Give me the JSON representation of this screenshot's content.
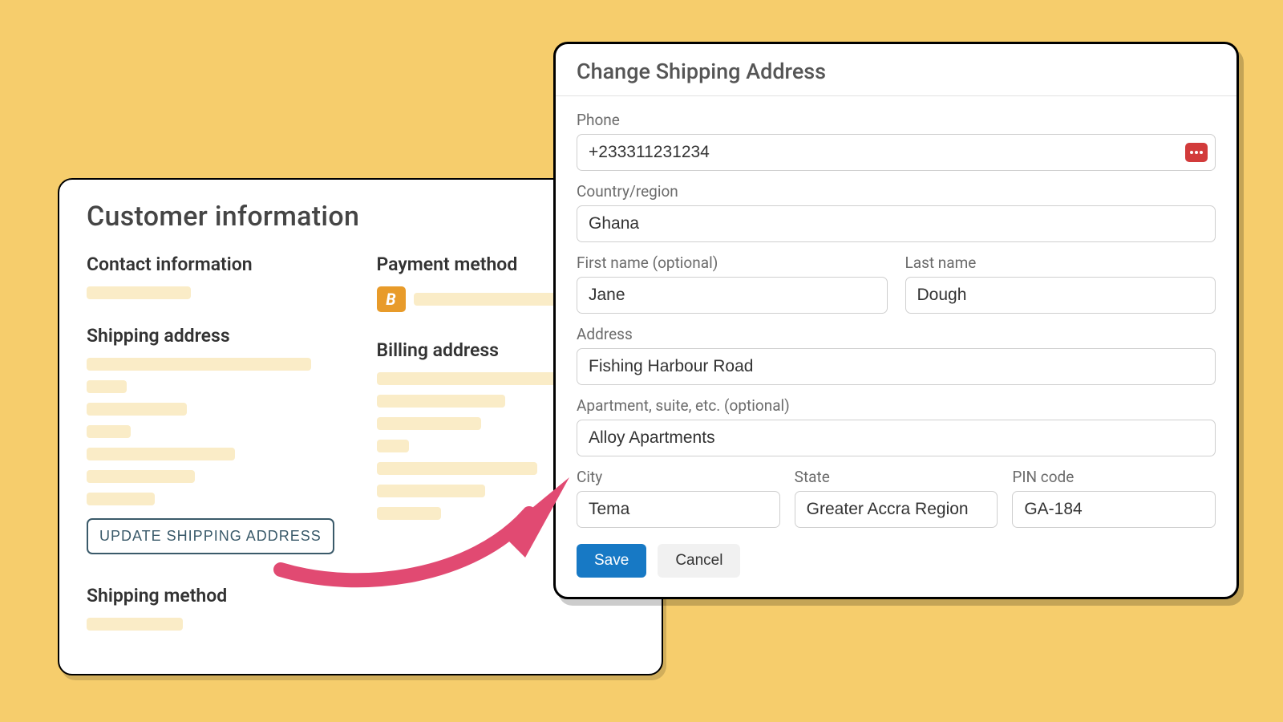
{
  "left": {
    "title": "Customer information",
    "contact_heading": "Contact information",
    "payment_heading": "Payment method",
    "payment_badge": "B",
    "shipping_heading": "Shipping address",
    "billing_heading": "Billing address",
    "update_button": "UPDATE SHIPPING ADDRESS",
    "shipping_method_heading": "Shipping method"
  },
  "modal": {
    "title": "Change Shipping Address",
    "phone_label": "Phone",
    "phone_value": "+233311231234",
    "country_label": "Country/region",
    "country_value": "Ghana",
    "first_name_label": "First name (optional)",
    "first_name_value": "Jane",
    "last_name_label": "Last name",
    "last_name_value": "Dough",
    "address_label": "Address",
    "address_value": "Fishing Harbour Road",
    "apt_label": "Apartment, suite, etc. (optional)",
    "apt_value": "Alloy Apartments",
    "city_label": "City",
    "city_value": "Tema",
    "state_label": "State",
    "state_value": "Greater Accra Region",
    "pin_label": "PIN code",
    "pin_value": "GA-184",
    "save_label": "Save",
    "cancel_label": "Cancel"
  }
}
